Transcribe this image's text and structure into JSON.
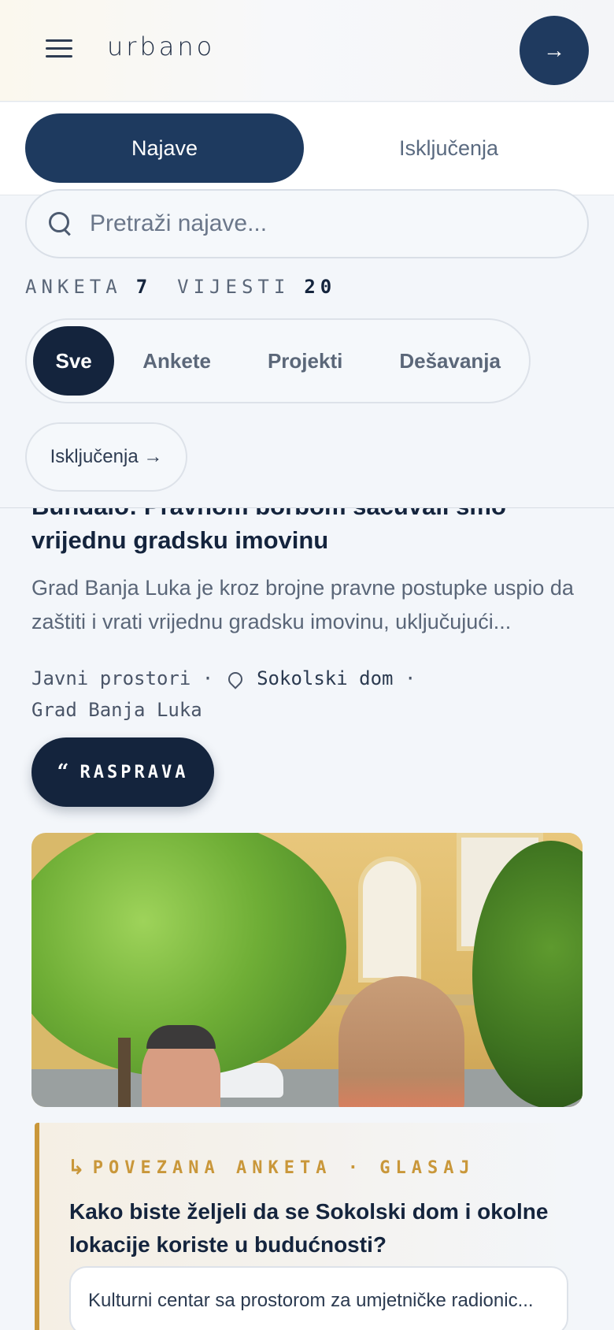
{
  "header": {
    "logo": "urbano",
    "go_icon": "arrow-right-icon",
    "menu_icon": "hamburger-icon"
  },
  "tabs": [
    {
      "label": "Najave",
      "active": true
    },
    {
      "label": "Isključenja",
      "active": false
    }
  ],
  "search": {
    "placeholder": "Pretraži najave..."
  },
  "stats": {
    "polls_label": "ANKETA",
    "polls_count": "7",
    "news_label": "VIJESTI",
    "news_count": "20"
  },
  "filters": [
    {
      "label": "Sve",
      "active": true
    },
    {
      "label": "Ankete"
    },
    {
      "label": "Projekti"
    },
    {
      "label": "Dešavanja"
    }
  ],
  "exclusions_link": "Isključenja →",
  "article": {
    "title": "Bundalo: Pravnom borbom sačuvali smo vrijednu gradsku imovinu",
    "excerpt": "Grad Banja Luka je kroz brojne pravne postupke uspio da zaštiti i vrati vrijednu gradsku imovinu, uključujući...",
    "category": "Javni prostori",
    "location": "Sokolski dom",
    "author": "Grad Banja Luka",
    "discuss_label": "RASPRAVA",
    "discuss_icon": "quote-icon"
  },
  "poll": {
    "tag": "POVEZANA ANKETA · GLASAJ",
    "question": "Kako biste željeli da se Sokolski dom i okolne lokacije koriste u budućnosti?",
    "option_1": "Kulturni centar sa prostorom za umjetničke radionic..."
  },
  "colors": {
    "primary": "#1e3a5f",
    "dark": "#14243d",
    "accent": "#c9973a",
    "background": "#f3f6fa"
  }
}
